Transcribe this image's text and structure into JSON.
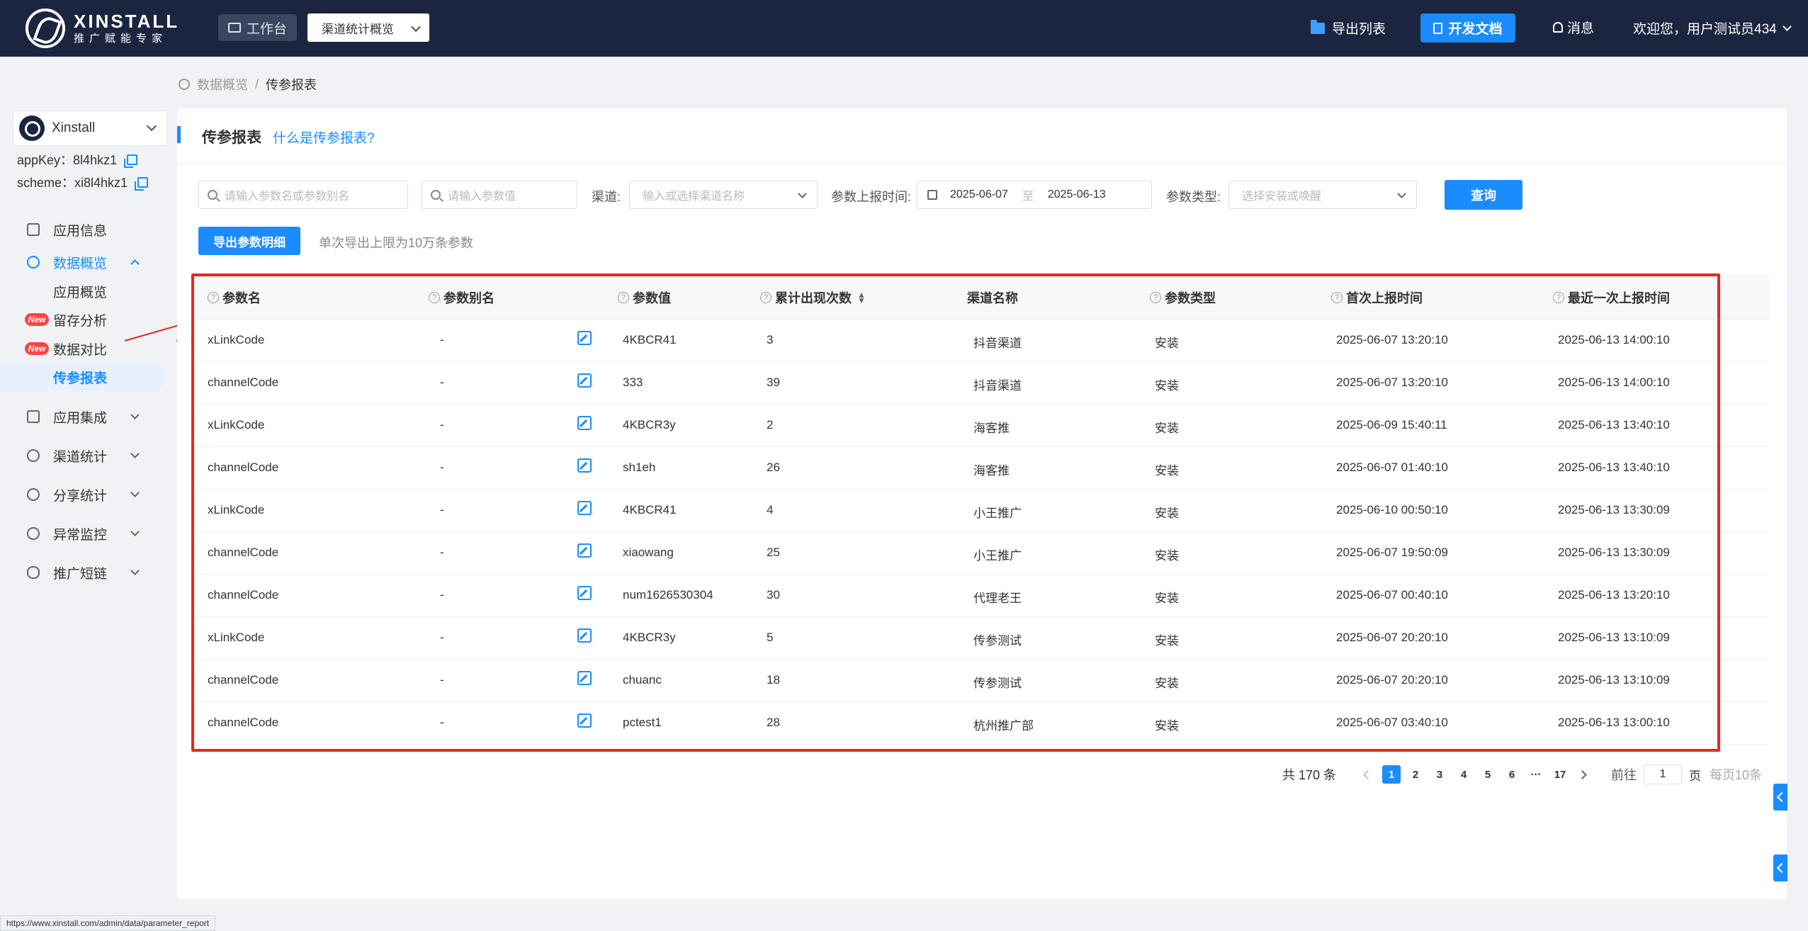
{
  "header": {
    "logo_title": "XINSTALL",
    "logo_sub": "推广赋能专家",
    "workspace_label": "工作台",
    "stats_select": "渠道统计概览",
    "export_list": "导出列表",
    "dev_docs": "开发文档",
    "messages": "消息",
    "welcome": "欢迎您，用户测试员434"
  },
  "sidebar": {
    "app_name": "Xinstall",
    "appkey_label": "appKey：8l4hkz1",
    "scheme_label": "scheme：xi8l4hkz1",
    "menu": {
      "app_info": "应用信息",
      "data_overview": "数据概览",
      "app_overview": "应用概览",
      "retention": "留存分析",
      "data_compare": "数据对比",
      "param_report": "传参报表",
      "app_integration": "应用集成",
      "channel_stats": "渠道统计",
      "share_stats": "分享统计",
      "anomaly": "异常监控",
      "short_link": "推广短链"
    },
    "new_badge": "New"
  },
  "breadcrumb": {
    "parent": "数据概览",
    "separator": "/",
    "current": "传参报表"
  },
  "card": {
    "title": "传参报表",
    "help_link": "什么是传参报表?"
  },
  "filters": {
    "param_name_placeholder": "请输入参数名或参数别名",
    "param_value_placeholder": "请输入参数值",
    "channel_label": "渠道:",
    "channel_placeholder": "输入或选择渠道名称",
    "time_label": "参数上报时间:",
    "date_start": "2025-06-07",
    "date_sep": "至",
    "date_end": "2025-06-13",
    "type_label": "参数类型:",
    "type_placeholder": "选择安装或唤醒",
    "query": "查询",
    "export": "导出参数明细",
    "export_note": "单次导出上限为10万条参数"
  },
  "table": {
    "headers": {
      "name": "参数名",
      "alias": "参数别名",
      "value": "参数值",
      "count": "累计出现次数",
      "channel": "渠道名称",
      "type": "参数类型",
      "first": "首次上报时间",
      "last": "最近一次上报时间"
    },
    "rows": [
      {
        "name": "xLinkCode",
        "alias": "-",
        "value": "4KBCR41",
        "count": "3",
        "channel": "抖音渠道",
        "type": "安装",
        "first": "2025-06-07 13:20:10",
        "last": "2025-06-13 14:00:10"
      },
      {
        "name": "channelCode",
        "alias": "-",
        "value": "333",
        "count": "39",
        "channel": "抖音渠道",
        "type": "安装",
        "first": "2025-06-07 13:20:10",
        "last": "2025-06-13 14:00:10"
      },
      {
        "name": "xLinkCode",
        "alias": "-",
        "value": "4KBCR3y",
        "count": "2",
        "channel": "海客推",
        "type": "安装",
        "first": "2025-06-09 15:40:11",
        "last": "2025-06-13 13:40:10"
      },
      {
        "name": "channelCode",
        "alias": "-",
        "value": "sh1eh",
        "count": "26",
        "channel": "海客推",
        "type": "安装",
        "first": "2025-06-07 01:40:10",
        "last": "2025-06-13 13:40:10"
      },
      {
        "name": "xLinkCode",
        "alias": "-",
        "value": "4KBCR41",
        "count": "4",
        "channel": "小王推广",
        "type": "安装",
        "first": "2025-06-10 00:50:10",
        "last": "2025-06-13 13:30:09"
      },
      {
        "name": "channelCode",
        "alias": "-",
        "value": "xiaowang",
        "count": "25",
        "channel": "小王推广",
        "type": "安装",
        "first": "2025-06-07 19:50:09",
        "last": "2025-06-13 13:30:09"
      },
      {
        "name": "channelCode",
        "alias": "-",
        "value": "num1626530304",
        "count": "30",
        "channel": "代理老王",
        "type": "安装",
        "first": "2025-06-07 00:40:10",
        "last": "2025-06-13 13:20:10"
      },
      {
        "name": "xLinkCode",
        "alias": "-",
        "value": "4KBCR3y",
        "count": "5",
        "channel": "传参测试",
        "type": "安装",
        "first": "2025-06-07 20:20:10",
        "last": "2025-06-13 13:10:09"
      },
      {
        "name": "channelCode",
        "alias": "-",
        "value": "chuanc",
        "count": "18",
        "channel": "传参测试",
        "type": "安装",
        "first": "2025-06-07 20:20:10",
        "last": "2025-06-13 13:10:09"
      },
      {
        "name": "channelCode",
        "alias": "-",
        "value": "pctest1",
        "count": "28",
        "channel": "杭州推广部",
        "type": "安装",
        "first": "2025-06-07 03:40:10",
        "last": "2025-06-13 13:00:10"
      }
    ]
  },
  "pagination": {
    "total": "共 170 条",
    "pages": [
      "1",
      "2",
      "3",
      "4",
      "5",
      "6",
      "···",
      "17"
    ],
    "goto_label": "前往",
    "goto_value": "1",
    "page_unit": "页",
    "page_size": "每页10条"
  },
  "status_url": "https://www.xinstall.com/admin/data/parameter_report",
  "colors": {
    "topbar": "#1b2540",
    "accent": "#1a8cff",
    "highlight": "#e8271f"
  }
}
